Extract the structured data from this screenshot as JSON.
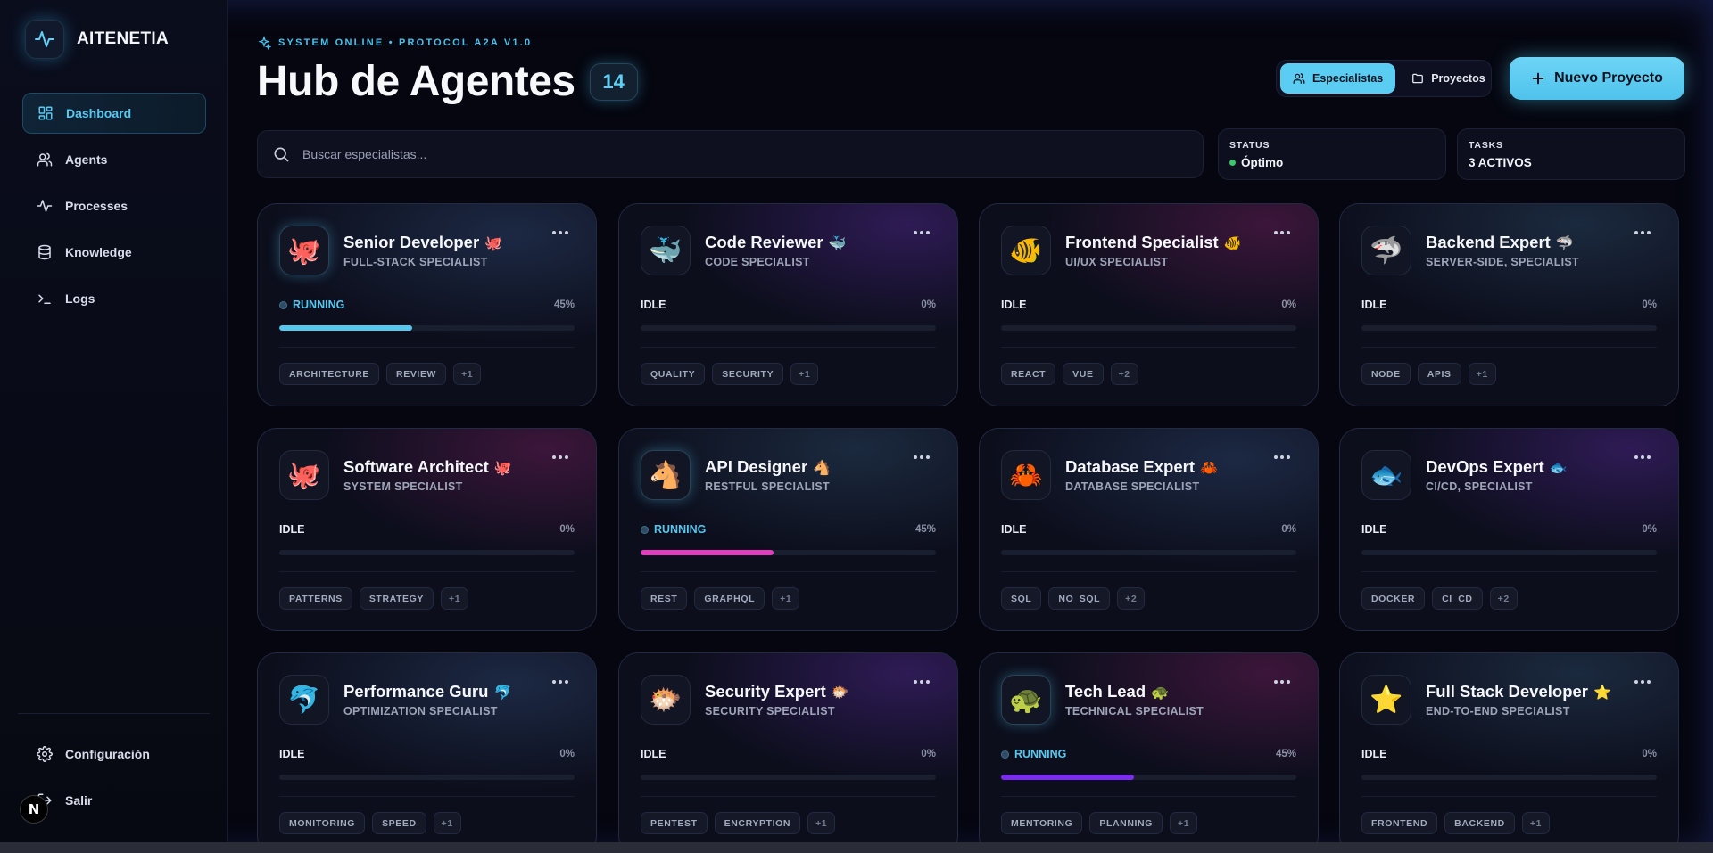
{
  "brand": {
    "name": "AITENETIA"
  },
  "nav": {
    "items": [
      {
        "label": "Dashboard",
        "icon": "dashboard-icon"
      },
      {
        "label": "Agents",
        "icon": "users-icon"
      },
      {
        "label": "Processes",
        "icon": "activity-icon"
      },
      {
        "label": "Knowledge",
        "icon": "database-icon"
      },
      {
        "label": "Logs",
        "icon": "terminal-icon"
      }
    ],
    "bottom": [
      {
        "label": "Configuración",
        "icon": "gear-icon"
      },
      {
        "label": "Salir",
        "icon": "logout-icon"
      }
    ],
    "avatar_letter": "N"
  },
  "header": {
    "eyebrow": "SYSTEM ONLINE • PROTOCOL A2A V1.0",
    "title": "Hub de Agentes",
    "count": "14",
    "toggle": {
      "specialists": "Especialistas",
      "projects": "Proyectos"
    },
    "new_project": "Nuevo Proyecto"
  },
  "search": {
    "placeholder": "Buscar especialistas..."
  },
  "stats": {
    "status": {
      "label": "STATUS",
      "value": "Óptimo"
    },
    "tasks": {
      "label": "TASKS",
      "value": "3 ACTIVOS"
    }
  },
  "colors": {
    "accent": "#56c8f0",
    "pink": "#e13ec0",
    "purple": "#7b2cf0",
    "ok": "#3ac66a"
  },
  "agents": [
    {
      "name": "Senior Developer",
      "emoji": "🐙",
      "subtitle": "FULL-STACK SPECIALIST",
      "status": "RUNNING",
      "running": true,
      "progress": "45%",
      "progress_value": 45,
      "bar_color": "#56c8f0",
      "tags": [
        "ARCHITECTURE",
        "REVIEW"
      ],
      "more": "+1"
    },
    {
      "name": "Code Reviewer",
      "emoji": "🐳",
      "subtitle": "CODE SPECIALIST",
      "status": "IDLE",
      "running": false,
      "progress": "0%",
      "progress_value": 0,
      "bar_color": "#56c8f0",
      "tags": [
        "QUALITY",
        "SECURITY"
      ],
      "more": "+1"
    },
    {
      "name": "Frontend Specialist",
      "emoji": "🐠",
      "subtitle": "UI/UX SPECIALIST",
      "status": "IDLE",
      "running": false,
      "progress": "0%",
      "progress_value": 0,
      "bar_color": "#56c8f0",
      "tags": [
        "REACT",
        "VUE"
      ],
      "more": "+2"
    },
    {
      "name": "Backend Expert",
      "emoji": "🦈",
      "subtitle": "SERVER-SIDE, SPECIALIST",
      "status": "IDLE",
      "running": false,
      "progress": "0%",
      "progress_value": 0,
      "bar_color": "#56c8f0",
      "tags": [
        "NODE",
        "APIS"
      ],
      "more": "+1"
    },
    {
      "name": "Software Architect",
      "emoji": "🐙",
      "subtitle": "SYSTEM SPECIALIST",
      "status": "IDLE",
      "running": false,
      "progress": "0%",
      "progress_value": 0,
      "bar_color": "#56c8f0",
      "tags": [
        "PATTERNS",
        "STRATEGY"
      ],
      "more": "+1"
    },
    {
      "name": "API Designer",
      "emoji": "🐴",
      "subtitle": "RESTFUL SPECIALIST",
      "status": "RUNNING",
      "running": true,
      "progress": "45%",
      "progress_value": 45,
      "bar_color": "#e13ec0",
      "tags": [
        "REST",
        "GRAPHQL"
      ],
      "more": "+1"
    },
    {
      "name": "Database Expert",
      "emoji": "🦀",
      "subtitle": "DATABASE SPECIALIST",
      "status": "IDLE",
      "running": false,
      "progress": "0%",
      "progress_value": 0,
      "bar_color": "#56c8f0",
      "tags": [
        "SQL",
        "NO_SQL"
      ],
      "more": "+2"
    },
    {
      "name": "DevOps Expert",
      "emoji": "🐟",
      "subtitle": "CI/CD, SPECIALIST",
      "status": "IDLE",
      "running": false,
      "progress": "0%",
      "progress_value": 0,
      "bar_color": "#56c8f0",
      "tags": [
        "DOCKER",
        "CI_CD"
      ],
      "more": "+2"
    },
    {
      "name": "Performance Guru",
      "emoji": "🐬",
      "subtitle": "OPTIMIZATION SPECIALIST",
      "status": "IDLE",
      "running": false,
      "progress": "0%",
      "progress_value": 0,
      "bar_color": "#56c8f0",
      "tags": [
        "MONITORING",
        "SPEED"
      ],
      "more": "+1"
    },
    {
      "name": "Security Expert",
      "emoji": "🐡",
      "subtitle": "SECURITY SPECIALIST",
      "status": "IDLE",
      "running": false,
      "progress": "0%",
      "progress_value": 0,
      "bar_color": "#56c8f0",
      "tags": [
        "PENTEST",
        "ENCRYPTION"
      ],
      "more": "+1"
    },
    {
      "name": "Tech Lead",
      "emoji": "🐢",
      "subtitle": "TECHNICAL SPECIALIST",
      "status": "RUNNING",
      "running": true,
      "progress": "45%",
      "progress_value": 45,
      "bar_color": "#7b2cf0",
      "tags": [
        "MENTORING",
        "PLANNING"
      ],
      "more": "+1"
    },
    {
      "name": "Full Stack Developer",
      "emoji": "⭐",
      "subtitle": "END-TO-END SPECIALIST",
      "status": "IDLE",
      "running": false,
      "progress": "0%",
      "progress_value": 0,
      "bar_color": "#56c8f0",
      "tags": [
        "FRONTEND",
        "BACKEND"
      ],
      "more": "+1"
    }
  ]
}
